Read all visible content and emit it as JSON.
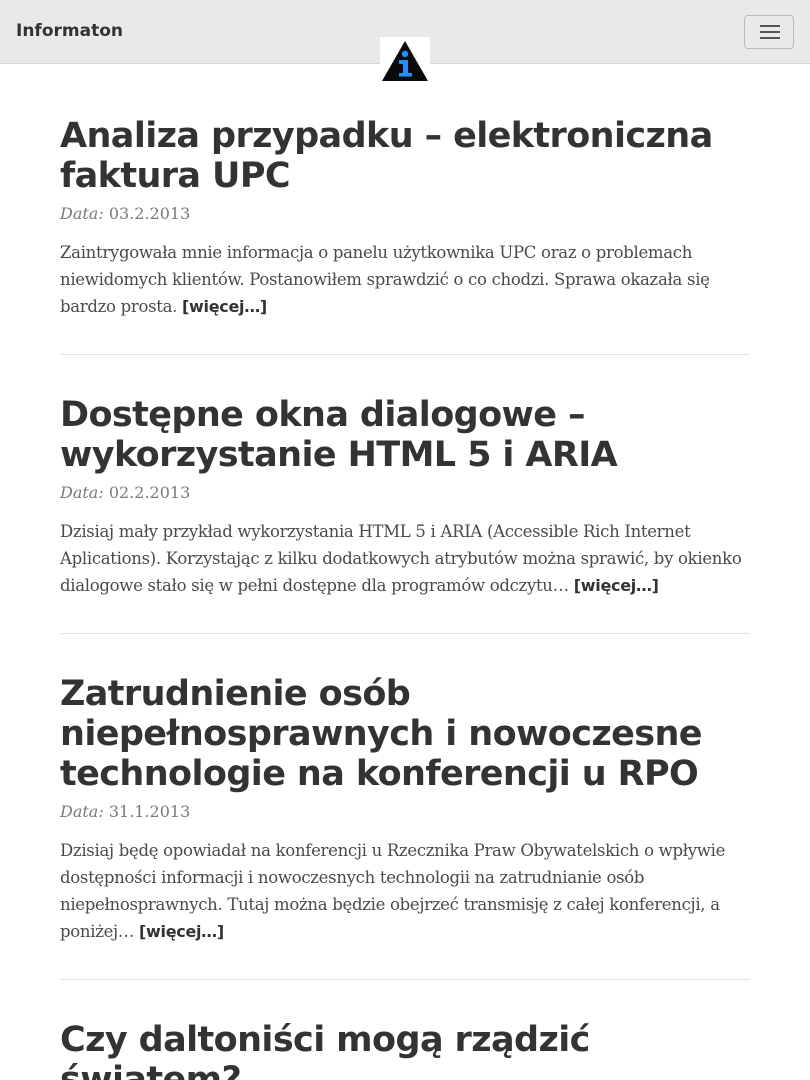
{
  "header": {
    "brand": "Informaton",
    "logo_icon": "info-triangle-icon",
    "menu_icon": "hamburger-menu-icon"
  },
  "articles": [
    {
      "title": "Analiza przypadku – elektroniczna faktura UPC",
      "date_label": "Data:",
      "date": "03.2.2013",
      "excerpt": "Zaintrygowała mnie informacja o panelu użytkownika UPC oraz o problemach niewidomych klientów. Postanowiłem sprawdzić o co chodzi. Sprawa okazała się bardzo prosta.",
      "more": "[więcej…]"
    },
    {
      "title": "Dostępne okna dialogowe – wykorzystanie HTML 5 i ARIA",
      "date_label": "Data:",
      "date": "02.2.2013",
      "excerpt": "Dzisiaj mały przykład wykorzystania HTML 5 i ARIA (Accessible Rich Internet Aplications). Korzystając z kilku dodatkowych atrybutów można sprawić, by okienko dialogowe stało się w pełni dostępne dla programów odczytu…",
      "more": "[więcej…]"
    },
    {
      "title": "Zatrudnienie osób niepełnosprawnych i nowoczesne technologie na konferencji u RPO",
      "date_label": "Data:",
      "date": "31.1.2013",
      "excerpt": "Dzisiaj będę opowiadał na konferencji u Rzecznika Praw Obywatelskich o wpływie dostępności informacji i nowoczesnych technologii na zatrudnianie osób niepełnosprawnych. Tutaj można będzie obejrzeć transmisję z całej konferencji, a poniżej…",
      "more": "[więcej…]"
    },
    {
      "title": "Czy daltoniści mogą rządzić światem?"
    }
  ],
  "colors": {
    "navbar_bg": "#e9e9e9",
    "text": "#333333",
    "muted": "#7a7a7a",
    "logo_blue": "#1e90ff"
  }
}
